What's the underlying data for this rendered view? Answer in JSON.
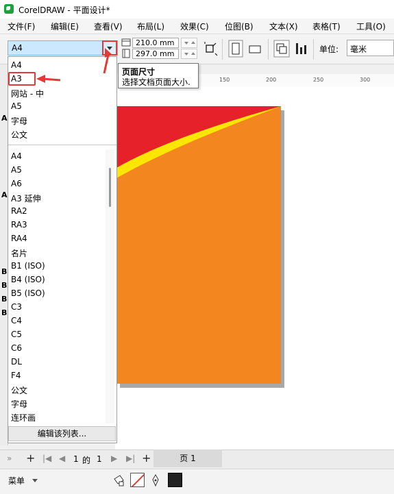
{
  "app": {
    "title": "CorelDRAW - 平面设计*"
  },
  "menu": [
    "文件(F)",
    "编辑(E)",
    "查看(V)",
    "布局(L)",
    "效果(C)",
    "位图(B)",
    "文本(X)",
    "表格(T)",
    "工具(O)"
  ],
  "propbar": {
    "page_size": "A4",
    "width": "210.0 mm",
    "height": "297.0 mm",
    "unit_label": "单位:",
    "unit_value": "毫米"
  },
  "ruler": {
    "ticks": [
      "150",
      "200",
      "250",
      "300"
    ]
  },
  "tooltip": {
    "title": "页面尺寸",
    "description": "选择文档页面大小."
  },
  "dropdown": {
    "recent": [
      "A4",
      "A3",
      "网站 - 中",
      "A5",
      "字母",
      "公文"
    ],
    "sizes": [
      "A4",
      "A5",
      "A6",
      "A3 延伸",
      "RA2",
      "RA3",
      "RA4",
      "名片",
      "B1 (ISO)",
      "B4 (ISO)",
      "B5 (ISO)",
      "C3",
      "C4",
      "C5",
      "C6",
      "DL",
      "F4",
      "公文",
      "字母",
      "连环画"
    ],
    "edit_button": "编辑该列表..."
  },
  "left_toolbox": [
    "A",
    "A",
    "B",
    "B",
    "B",
    "B"
  ],
  "page_nav": {
    "current": "1",
    "of_label": "的",
    "total": "1",
    "tab_label": "页 1"
  },
  "status": {
    "menu_label": "菜单"
  },
  "colors": {
    "page_orange": "#f4861f",
    "arc_red": "#e62129",
    "arc_yellow": "#ffe600",
    "highlight_red": "#e53935"
  },
  "icons": [
    "coreldraw-logo-icon",
    "dropdown-arrow-icon",
    "page-width-icon",
    "page-height-icon",
    "spin-icon",
    "resize-page-icon",
    "portrait-icon",
    "landscape-icon",
    "all-pages-icon",
    "current-page-icon",
    "fill-icon",
    "pen-icon"
  ]
}
